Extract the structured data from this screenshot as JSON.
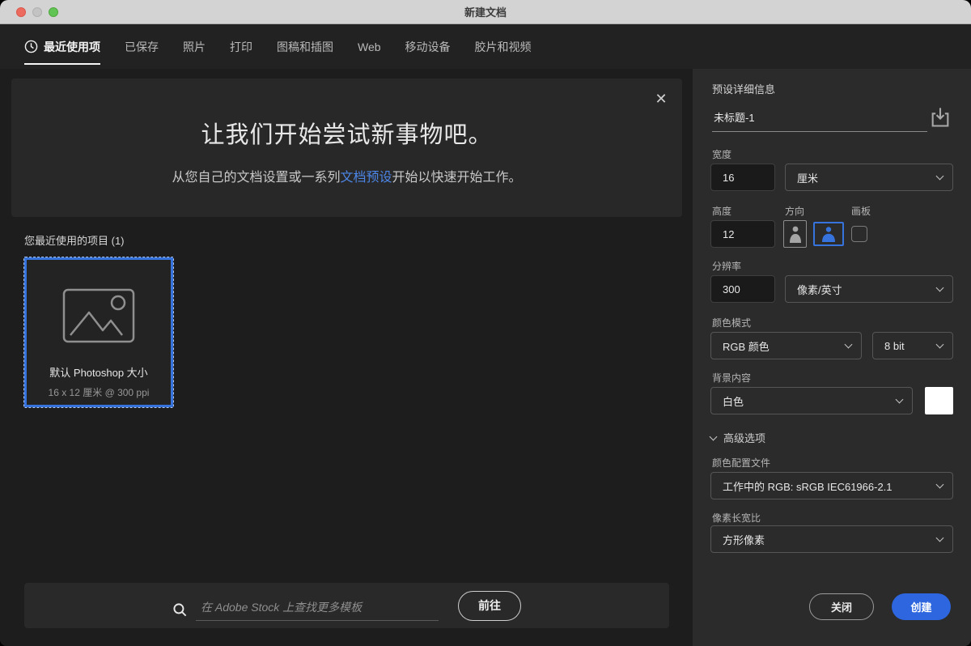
{
  "window": {
    "title": "新建文档"
  },
  "tabs": {
    "items": [
      {
        "label": "最近使用项"
      },
      {
        "label": "已保存"
      },
      {
        "label": "照片"
      },
      {
        "label": "打印"
      },
      {
        "label": "图稿和插图"
      },
      {
        "label": "Web"
      },
      {
        "label": "移动设备"
      },
      {
        "label": "胶片和视频"
      }
    ]
  },
  "hero": {
    "title": "让我们开始尝试新事物吧。",
    "subtitle_pre": "从您自己的文档设置或一系列",
    "subtitle_link": "文档预设",
    "subtitle_post": "开始以快速开始工作。",
    "close_glyph": "✕"
  },
  "recent": {
    "section_label": "您最近使用的项目 (1)",
    "card": {
      "title": "默认 Photoshop 大小",
      "subtitle": "16 x 12 厘米 @ 300 ppi"
    }
  },
  "search": {
    "placeholder": "在 Adobe Stock 上查找更多模板",
    "go_label": "前往"
  },
  "panel": {
    "header": "预设详细信息",
    "name_value": "未标题-1",
    "width_label": "宽度",
    "width_value": "16",
    "unit_value": "厘米",
    "height_label": "高度",
    "height_value": "12",
    "orientation_label": "方向",
    "artboard_label": "画板",
    "resolution_label": "分辨率",
    "resolution_value": "300",
    "resolution_unit": "像素/英寸",
    "color_mode_label": "颜色模式",
    "color_mode_value": "RGB 颜色",
    "bit_depth_value": "8 bit",
    "background_label": "背景内容",
    "background_value": "白色",
    "advanced_label": "高级选项",
    "color_profile_label": "颜色配置文件",
    "color_profile_value": "工作中的 RGB: sRGB IEC61966-2.1",
    "pixel_ratio_label": "像素长宽比",
    "pixel_ratio_value": "方形像素",
    "close_label": "关闭",
    "create_label": "创建"
  },
  "colors": {
    "accent_blue": "#2d66de",
    "selection_blue": "#3673dc",
    "link_blue": "#4c86e8",
    "titlebar_gray": "#d3d3d3"
  }
}
